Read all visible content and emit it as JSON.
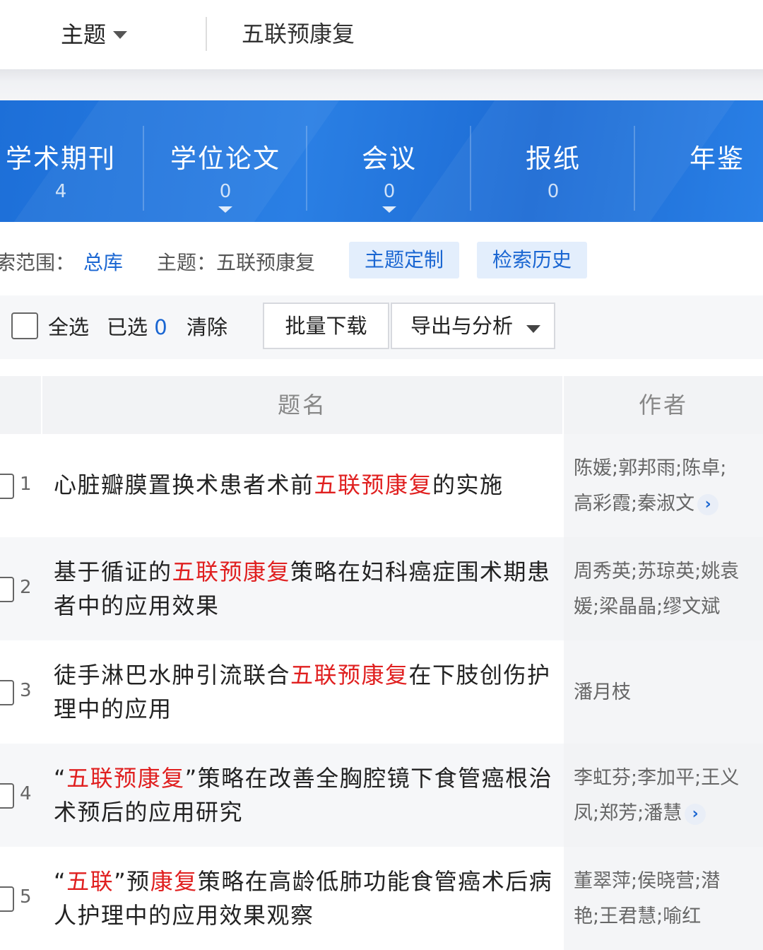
{
  "search": {
    "field": "主题",
    "query": "五联预康复"
  },
  "tabs": [
    {
      "label": "学术期刊",
      "count": "4"
    },
    {
      "label": "学位论文",
      "count": "0"
    },
    {
      "label": "会议",
      "count": "0"
    },
    {
      "label": "报纸",
      "count": "0"
    },
    {
      "label": "年鉴",
      "count": ""
    }
  ],
  "scope": {
    "label": "索范围：",
    "value": "总库",
    "topic": "主题：五联预康复",
    "custom_button": "主题定制",
    "history_button": "检索历史"
  },
  "actions": {
    "select_all": "全选",
    "selected_label": "已选",
    "selected_count": "0",
    "clear": "清除",
    "batch_download": "批量下载",
    "export_analyze": "导出与分析"
  },
  "table": {
    "headers": {
      "title": "题名",
      "author": "作者"
    },
    "rows": [
      {
        "num": "1",
        "title_parts": [
          "心脏瓣膜置换术患者术前",
          "五联预康复",
          "的实施"
        ],
        "author_lines": [
          "陈媛;郭邦雨;陈卓;",
          "高彩霞;秦淑文"
        ],
        "has_more": true
      },
      {
        "num": "2",
        "title_parts": [
          "基于循证的",
          "五联预康复",
          "策略在妇科癌症围术期患者中的应用效果"
        ],
        "author_lines": [
          "周秀英;苏琼英;姚袁",
          "媛;梁晶晶;缪文斌"
        ],
        "has_more": false
      },
      {
        "num": "3",
        "title_parts": [
          "徒手淋巴水肿引流联合",
          "五联预康复",
          "在下肢创伤护理中的应用"
        ],
        "author_lines": [
          "潘月枝"
        ],
        "has_more": false
      },
      {
        "num": "4",
        "title_parts": [
          "“",
          "五联预康复",
          "”策略在改善全胸腔镜下食管癌根治术预后的应用研究"
        ],
        "author_lines": [
          "李虹芬;李加平;王义",
          "凤;郑芳;潘慧"
        ],
        "has_more": true
      },
      {
        "num": "5",
        "title_parts": [
          "“",
          "五联",
          "”预",
          "康复",
          "策略在高龄低肺功能食管癌术后病人护理中的应用效果观察"
        ],
        "author_lines": [
          "董翠萍;侯晓营;潜",
          "艳;王君慧;喻红"
        ],
        "has_more": false
      }
    ]
  }
}
